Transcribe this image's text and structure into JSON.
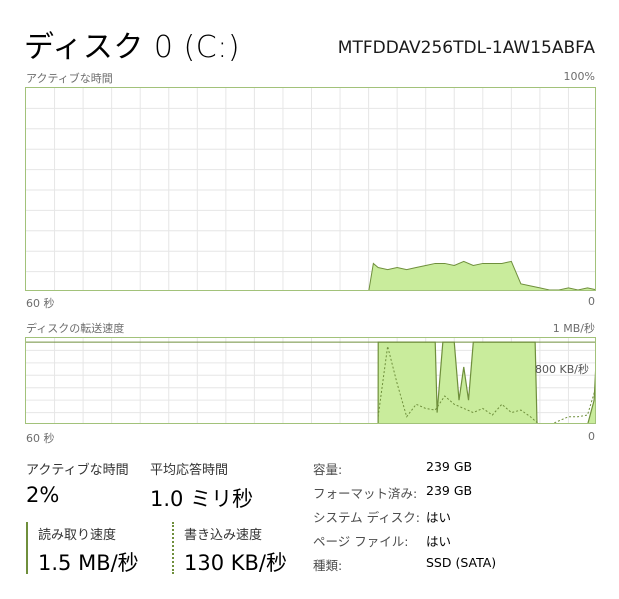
{
  "header": {
    "title": "ディスク 0 (C:)",
    "model": "MTFDDAV256TDL-1AW15ABFA"
  },
  "colors": {
    "border": "#a2c27a",
    "fill": "#c9ec9c",
    "line": "#6f8f3c",
    "grid": "#e6e6e6"
  },
  "active_chart": {
    "label": "アクティブな時間",
    "max_label": "100%",
    "time_label": "60 秒",
    "min_label": "0"
  },
  "transfer_chart": {
    "label": "ディスクの転送速度",
    "max_label": "1 MB/秒",
    "ref_label": "800 KB/秒",
    "time_label": "60 秒",
    "min_label": "0"
  },
  "chart_data": [
    {
      "type": "area",
      "title": "アクティブな時間",
      "x": [
        0,
        36,
        36.5,
        37,
        38,
        39,
        40,
        41,
        42,
        43,
        44,
        45,
        46,
        47,
        48,
        49,
        50,
        51,
        52,
        53,
        54,
        55,
        56,
        57,
        58,
        59,
        60
      ],
      "values": [
        0,
        0,
        14,
        12,
        11,
        12,
        11,
        12,
        13,
        14,
        14,
        13,
        15,
        13,
        14,
        14,
        14,
        15,
        4,
        3,
        2,
        1,
        1,
        2,
        1,
        2,
        1
      ],
      "ylim": [
        0,
        100
      ],
      "xlim": [
        0,
        60
      ],
      "grid": true
    },
    {
      "type": "area",
      "title": "ディスクの転送速度",
      "series": [
        {
          "x": [
            0,
            37,
            37.01,
            39.5,
            40,
            43,
            43.2,
            43.8,
            44,
            45,
            45.5,
            46,
            46.5,
            47,
            48,
            51,
            52,
            53.5,
            53.7,
            55,
            57,
            58,
            59,
            59.7,
            60
          ],
          "values": [
            0,
            0,
            1,
            1,
            1,
            1,
            0.15,
            1,
            1,
            1,
            0.3,
            0.7,
            0.3,
            1,
            1,
            1,
            1,
            1,
            0,
            0,
            0,
            0,
            0,
            0.3,
            1
          ]
        },
        {
          "x": [
            37,
            38,
            39,
            40,
            41,
            42,
            43,
            44,
            45,
            46,
            47,
            48,
            49,
            50,
            51,
            52,
            53,
            54,
            55,
            56,
            57,
            58,
            59,
            60
          ],
          "values": [
            0.1,
            0.95,
            0.5,
            0.1,
            0.25,
            0.2,
            0.18,
            0.35,
            0.25,
            0.2,
            0.15,
            0.2,
            0.12,
            0.25,
            0.15,
            0.18,
            0.1,
            0,
            0,
            0.05,
            0.1,
            0.1,
            0.12,
            0.5
          ]
        }
      ],
      "ylim": [
        0,
        1.05
      ],
      "xlim": [
        0,
        60
      ],
      "grid": true
    }
  ],
  "stats": {
    "active_time_label": "アクティブな時間",
    "active_time_value": "2%",
    "response_label": "平均応答時間",
    "response_value": "1.0 ミリ秒",
    "read_label": "読み取り速度",
    "read_value": "1.5 MB/秒",
    "write_label": "書き込み速度",
    "write_value": "130 KB/秒"
  },
  "info": [
    {
      "key": "容量:",
      "value": "239 GB"
    },
    {
      "key": "フォーマット済み:",
      "value": "239 GB"
    },
    {
      "key": "システム ディスク:",
      "value": "はい"
    },
    {
      "key": "ページ ファイル:",
      "value": "はい"
    },
    {
      "key": "種類:",
      "value": "SSD (SATA)"
    }
  ]
}
